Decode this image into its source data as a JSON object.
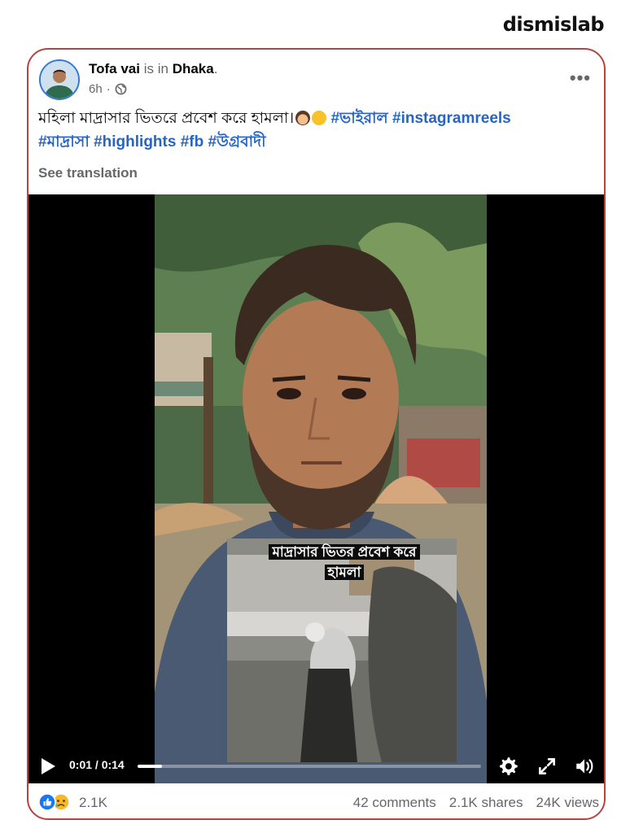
{
  "brand": "dismislab",
  "post": {
    "author": "Tofa vai",
    "is_in": "is in",
    "location": "Dhaka",
    "location_suffix": ".",
    "time": "6h",
    "privacy_icon": "globe-icon",
    "more_label": "•••",
    "caption_text": "মহিলা মাদ্রাসার ভিতরে প্রবেশ করে হামলা।",
    "caption_emojis": [
      "woman-emoji",
      "crying-face-emoji"
    ],
    "hashtags": [
      "#ভাইরাল",
      "#instagramreels",
      "#মাদ্রাসা",
      "#highlights",
      "#fb",
      "#উগ্রবাদী"
    ],
    "see_translation": "See translation"
  },
  "video": {
    "overlay_line1": "মাদ্রাসার ভিতর প্রবেশ করে",
    "overlay_line2": "হামলা",
    "time_display": "0:01 / 0:14",
    "progress": 0.07,
    "icons": [
      "play-icon",
      "settings-icon",
      "fullscreen-icon",
      "volume-icon"
    ]
  },
  "footer": {
    "reactions": "2.1K",
    "reaction_icons": [
      "like-icon",
      "sad-icon"
    ],
    "comments": "42 comments",
    "shares": "2.1K shares",
    "views": "24K views"
  },
  "colors": {
    "frame_border": "#b8433f",
    "hashtag": "#2664c8",
    "like_blue": "#1877f2",
    "sad_yellow": "#f7b928"
  }
}
